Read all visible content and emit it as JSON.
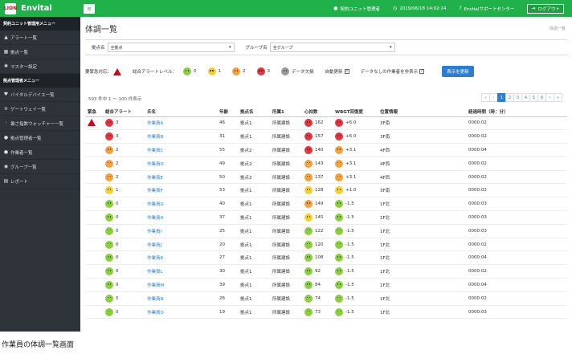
{
  "brand": {
    "logo_badge": "LION",
    "name": "Envital"
  },
  "topbar": {
    "user": "契約ユニット管理者",
    "datetime": "2019/06/18 14:02:24",
    "support": "Envitalサポートセンター",
    "logout": "ログアウト"
  },
  "sidebar": {
    "section1": "契約ユニット管理用メニュー",
    "section2": "拠点管理者メニュー",
    "items1": [
      {
        "label": "アラート一覧",
        "icon": "warning-icon"
      },
      {
        "label": "拠点一覧",
        "icon": "building-icon"
      },
      {
        "label": "マスター設定",
        "icon": "gear-icon"
      }
    ],
    "items2": [
      {
        "label": "バイタルデバイス一覧",
        "icon": "heart-icon"
      },
      {
        "label": "ゲートウェイ一覧",
        "icon": "wifi-icon"
      },
      {
        "label": "暑さ指数ウォッチャー一覧",
        "icon": "thermometer-icon"
      },
      {
        "label": "拠点管理者一覧",
        "icon": "user-icon"
      },
      {
        "label": "作業者一覧",
        "icon": "user-icon"
      },
      {
        "label": "グループ一覧",
        "icon": "group-icon"
      },
      {
        "label": "レポート",
        "icon": "report-icon"
      }
    ]
  },
  "page": {
    "title": "体調一覧",
    "breadcrumb": "体調一覧"
  },
  "filters": {
    "site_label": "拠点名",
    "site_value": "全拠点",
    "group_label": "グループ名",
    "group_value": "全グループ"
  },
  "legend": {
    "emergency": "要緊急対応：",
    "total_alert": "総合アラートレベル：",
    "levels": [
      "0",
      "1",
      "2",
      "3"
    ],
    "no_data": "データ欠損",
    "auto_update": "自動更新",
    "show_no_data": "データなしの作業者を非表示",
    "refresh": "表示を更新"
  },
  "list": {
    "count": "593 件中 1 ～ 100 件表示",
    "pages": [
      "«",
      "‹",
      "1",
      "2",
      "3",
      "4",
      "5",
      "6",
      "›",
      "»"
    ],
    "headers": [
      "緊急",
      "総合アラート",
      "氏名",
      "年齢",
      "拠点名",
      "所属1",
      "心拍数",
      "WBGT回復度",
      "位置情報",
      "経過時間（時：分）"
    ],
    "rows": [
      {
        "emg": true,
        "lv": "r",
        "alert": "3",
        "name": "作業員A",
        "age": "46",
        "site": "拠点1",
        "dept": "所属建設",
        "hrlv": "r",
        "hr": "162",
        "wblv": "r",
        "wb": "+6.0",
        "loc": "3F南",
        "time": "0000:02"
      },
      {
        "emg": false,
        "lv": "r",
        "alert": "3",
        "name": "作業員B",
        "age": "31",
        "site": "拠点1",
        "dept": "所属建設",
        "hrlv": "r",
        "hr": "157",
        "wblv": "r",
        "wb": "+6.0",
        "loc": "3F南",
        "time": "0000:02"
      },
      {
        "emg": false,
        "lv": "o",
        "alert": "2",
        "name": "作業員C",
        "age": "55",
        "site": "拠点2",
        "dept": "所属建設",
        "hrlv": "r",
        "hr": "140",
        "wblv": "o",
        "wb": "+3.1",
        "loc": "4F西",
        "time": "0000:04"
      },
      {
        "emg": false,
        "lv": "o",
        "alert": "2",
        "name": "作業員D",
        "age": "49",
        "site": "拠点2",
        "dept": "所属建設",
        "hrlv": "o",
        "hr": "143",
        "wblv": "o",
        "wb": "+3.1",
        "loc": "4F西",
        "time": "0000:02"
      },
      {
        "emg": false,
        "lv": "o",
        "alert": "2",
        "name": "作業員E",
        "age": "50",
        "site": "拠点2",
        "dept": "所属建設",
        "hrlv": "o",
        "hr": "137",
        "wblv": "o",
        "wb": "+3.1",
        "loc": "4F西",
        "time": "0000:02"
      },
      {
        "emg": false,
        "lv": "y",
        "alert": "1",
        "name": "作業員F",
        "age": "53",
        "site": "拠点1",
        "dept": "所属建設",
        "hrlv": "y",
        "hr": "128",
        "wblv": "y",
        "wb": "+1.0",
        "loc": "3F南",
        "time": "0000:02"
      },
      {
        "emg": false,
        "lv": "g",
        "alert": "0",
        "name": "作業員G",
        "age": "40",
        "site": "拠点1",
        "dept": "所属建設",
        "hrlv": "o",
        "hr": "149",
        "wblv": "g",
        "wb": "-1.5",
        "loc": "1F北",
        "time": "0000:03"
      },
      {
        "emg": false,
        "lv": "g",
        "alert": "0",
        "name": "作業員H",
        "age": "37",
        "site": "拠点1",
        "dept": "所属建設",
        "hrlv": "y",
        "hr": "145",
        "wblv": "g",
        "wb": "-1.5",
        "loc": "1F北",
        "time": "0000:03"
      },
      {
        "emg": false,
        "lv": "g",
        "alert": "0",
        "name": "作業員I",
        "age": "25",
        "site": "拠点1",
        "dept": "所属建設",
        "hrlv": "g",
        "hr": "122",
        "wblv": "g",
        "wb": "-1.5",
        "loc": "1F北",
        "time": "0000:03"
      },
      {
        "emg": false,
        "lv": "g",
        "alert": "0",
        "name": "作業員J",
        "age": "20",
        "site": "拠点1",
        "dept": "所属建設",
        "hrlv": "g",
        "hr": "120",
        "wblv": "g",
        "wb": "-1.5",
        "loc": "1F北",
        "time": "0000:02"
      },
      {
        "emg": false,
        "lv": "g",
        "alert": "0",
        "name": "作業員K",
        "age": "27",
        "site": "拠点1",
        "dept": "所属建設",
        "hrlv": "g",
        "hr": "108",
        "wblv": "g",
        "wb": "-1.5",
        "loc": "1F北",
        "time": "0000:04"
      },
      {
        "emg": false,
        "lv": "g",
        "alert": "0",
        "name": "作業員L",
        "age": "30",
        "site": "拠点1",
        "dept": "所属建設",
        "hrlv": "g",
        "hr": "92",
        "wblv": "g",
        "wb": "-1.5",
        "loc": "1F北",
        "time": "0000:02"
      },
      {
        "emg": false,
        "lv": "g",
        "alert": "0",
        "name": "作業員M",
        "age": "39",
        "site": "拠点1",
        "dept": "所属建設",
        "hrlv": "g",
        "hr": "84",
        "wblv": "g",
        "wb": "-1.5",
        "loc": "1F北",
        "time": "0000:04"
      },
      {
        "emg": false,
        "lv": "g",
        "alert": "0",
        "name": "作業員N",
        "age": "26",
        "site": "拠点1",
        "dept": "所属建設",
        "hrlv": "g",
        "hr": "74",
        "wblv": "g",
        "wb": "-1.5",
        "loc": "1F北",
        "time": "0000:02"
      },
      {
        "emg": false,
        "lv": "g",
        "alert": "0",
        "name": "作業員O",
        "age": "19",
        "site": "拠点1",
        "dept": "所属建設",
        "hrlv": "g",
        "hr": "73",
        "wblv": "g",
        "wb": "-1.5",
        "loc": "1F北",
        "time": "0000:03"
      }
    ]
  },
  "caption": "作業員の体調一覧画面"
}
